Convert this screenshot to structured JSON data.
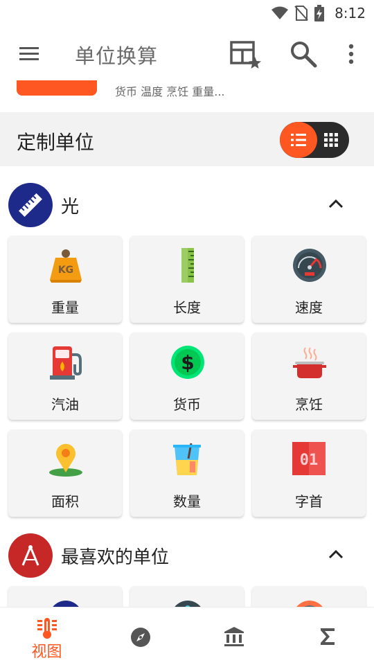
{
  "status_bar": {
    "time": "8:12"
  },
  "app_bar": {
    "title": "单位换算"
  },
  "banner": {
    "subtitle": "货币 温度 烹饪 重量..."
  },
  "section": {
    "title": "定制单位"
  },
  "categories": [
    {
      "title": "光",
      "avatar_color": "#1e2a8a",
      "icon": "ruler-icon",
      "items": [
        {
          "label": "重量",
          "icon": "weight-kg-icon"
        },
        {
          "label": "长度",
          "icon": "ruler-icon"
        },
        {
          "label": "速度",
          "icon": "speedometer-icon"
        },
        {
          "label": "汽油",
          "icon": "gas-pump-icon"
        },
        {
          "label": "货币",
          "icon": "dollar-coin-icon"
        },
        {
          "label": "烹饪",
          "icon": "cooking-pot-icon"
        },
        {
          "label": "面积",
          "icon": "map-pin-icon"
        },
        {
          "label": "数量",
          "icon": "measuring-cup-icon"
        },
        {
          "label": "字首",
          "icon": "binary-01-icon"
        }
      ]
    },
    {
      "title": "最喜欢的单位",
      "avatar_color": "#c62828",
      "icon": "compass-drawing-icon"
    }
  ],
  "bottom_nav": {
    "active_label": "视图"
  },
  "colors": {
    "accent": "#ff5722",
    "toggle_dark": "#2b2b2b"
  }
}
